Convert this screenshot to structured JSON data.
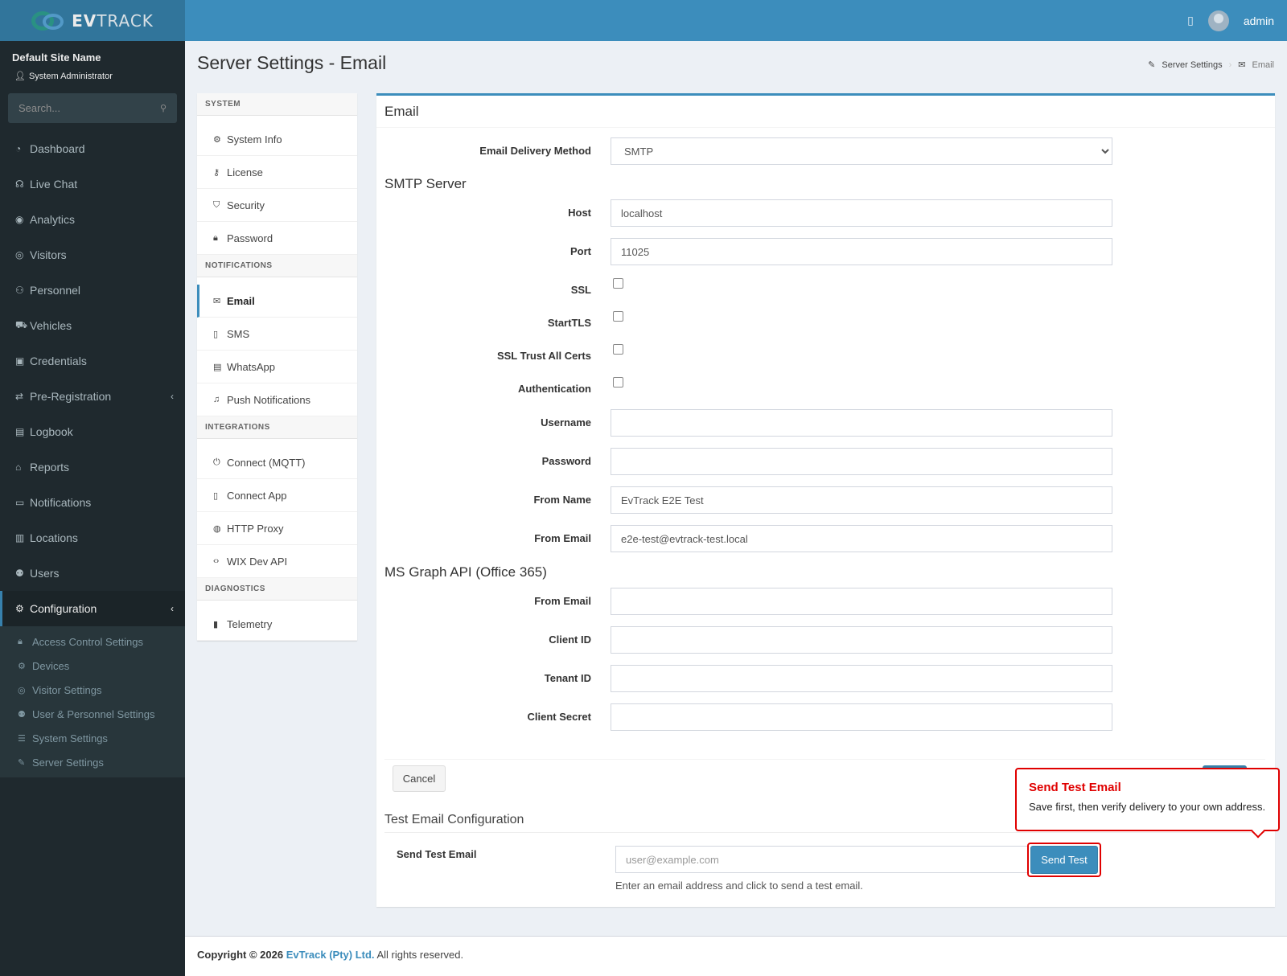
{
  "header": {
    "brand_prefix": "EV",
    "brand_suffix": "TRACK",
    "user": "admin"
  },
  "sidebar": {
    "site_name": "Default Site Name",
    "role": "System Administrator",
    "search_placeholder": "Search...",
    "items": [
      {
        "label": "Dashboard",
        "icon": "dashboard-icon"
      },
      {
        "label": "Live Chat",
        "icon": "headset-icon"
      },
      {
        "label": "Analytics",
        "icon": "target-icon"
      },
      {
        "label": "Visitors",
        "icon": "eye-icon"
      },
      {
        "label": "Personnel",
        "icon": "user-group-icon"
      },
      {
        "label": "Vehicles",
        "icon": "car-icon"
      },
      {
        "label": "Credentials",
        "icon": "id-badge-icon"
      },
      {
        "label": "Pre-Registration",
        "icon": "arrows-icon"
      },
      {
        "label": "Logbook",
        "icon": "book-icon"
      },
      {
        "label": "Reports",
        "icon": "chart-icon"
      },
      {
        "label": "Notifications",
        "icon": "chat-icon"
      },
      {
        "label": "Locations",
        "icon": "map-icon"
      },
      {
        "label": "Users",
        "icon": "users-icon"
      },
      {
        "label": "Configuration",
        "icon": "gear-icon"
      }
    ],
    "config_sub": [
      {
        "label": "Access Control Settings",
        "icon": "lock-icon"
      },
      {
        "label": "Devices",
        "icon": "cog-icon"
      },
      {
        "label": "Visitor Settings",
        "icon": "eye-icon"
      },
      {
        "label": "User & Personnel Settings",
        "icon": "users-icon"
      },
      {
        "label": "System Settings",
        "icon": "sliders-icon"
      },
      {
        "label": "Server Settings",
        "icon": "wrench-icon"
      }
    ]
  },
  "page": {
    "title": "Server Settings - Email",
    "breadcrumb": [
      "Server Settings",
      "Email"
    ]
  },
  "settings_nav": {
    "system_head": "SYSTEM",
    "system": [
      "System Info",
      "License",
      "Security",
      "Password"
    ],
    "notifications_head": "NOTIFICATIONS",
    "notifications": [
      "Email",
      "SMS",
      "WhatsApp",
      "Push Notifications"
    ],
    "integrations_head": "INTEGRATIONS",
    "integrations": [
      "Connect (MQTT)",
      "Connect App",
      "HTTP Proxy",
      "WIX Dev API"
    ],
    "diagnostics_head": "DIAGNOSTICS",
    "diagnostics": [
      "Telemetry"
    ]
  },
  "form": {
    "box_title": "Email",
    "delivery_label": "Email Delivery Method",
    "delivery_value": "SMTP",
    "smtp_title": "SMTP Server",
    "host_label": "Host",
    "host_value": "localhost",
    "port_label": "Port",
    "port_value": "11025",
    "ssl_label": "SSL",
    "starttls_label": "StartTLS",
    "trust_label": "SSL Trust All Certs",
    "auth_label": "Authentication",
    "username_label": "Username",
    "password_label": "Password",
    "from_name_label": "From Name",
    "from_name_value": "EvTrack E2E Test",
    "from_email_label": "From Email",
    "from_email_value": "e2e-test@evtrack-test.local",
    "graph_title": "MS Graph API (Office 365)",
    "graph_from_label": "From Email",
    "client_id_label": "Client ID",
    "tenant_id_label": "Tenant ID",
    "client_secret_label": "Client Secret",
    "cancel_label": "Cancel",
    "test_title": "Test Email Configuration",
    "test_label": "Send Test Email",
    "test_placeholder": "user@example.com",
    "send_label": "Send Test",
    "test_help": "Enter an email address and click to send a test email."
  },
  "tooltip": {
    "title": "Send Test Email",
    "text": "Save first, then verify delivery to your own address."
  },
  "footer": {
    "copyright": "Copyright © 2026",
    "company": "EvTrack (Pty) Ltd.",
    "rights": "All rights reserved."
  }
}
